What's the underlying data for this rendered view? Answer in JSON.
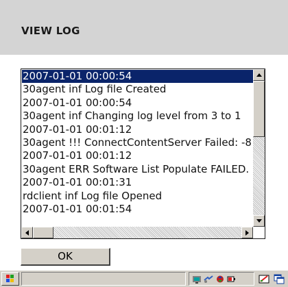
{
  "header": {
    "title": "VIEW LOG"
  },
  "log": {
    "lines": [
      "2007-01-01 00:00:54",
      "30agent inf Log file Created",
      "2007-01-01 00:00:54",
      "30agent inf Changing log level from 3 to 1",
      "2007-01-01 00:01:12",
      "30agent !!! ConnectContentServer Failed: -8",
      "2007-01-01 00:01:12",
      "30agent ERR Software List Populate FAILED.",
      "2007-01-01 00:01:31",
      "rdclient inf Log file Opened",
      "2007-01-01 00:01:54"
    ],
    "selected_index": 0
  },
  "buttons": {
    "ok_label": "OK"
  },
  "taskbar": {
    "icons": [
      "start-flag-icon",
      "network-icon",
      "connection-icon",
      "sync-icon",
      "power-icon",
      "input-panel-icon",
      "window-switch-icon"
    ]
  },
  "colors": {
    "selection": "#0a246a",
    "header_bg": "#d4d4d4",
    "chrome": "#d4d0c8"
  }
}
